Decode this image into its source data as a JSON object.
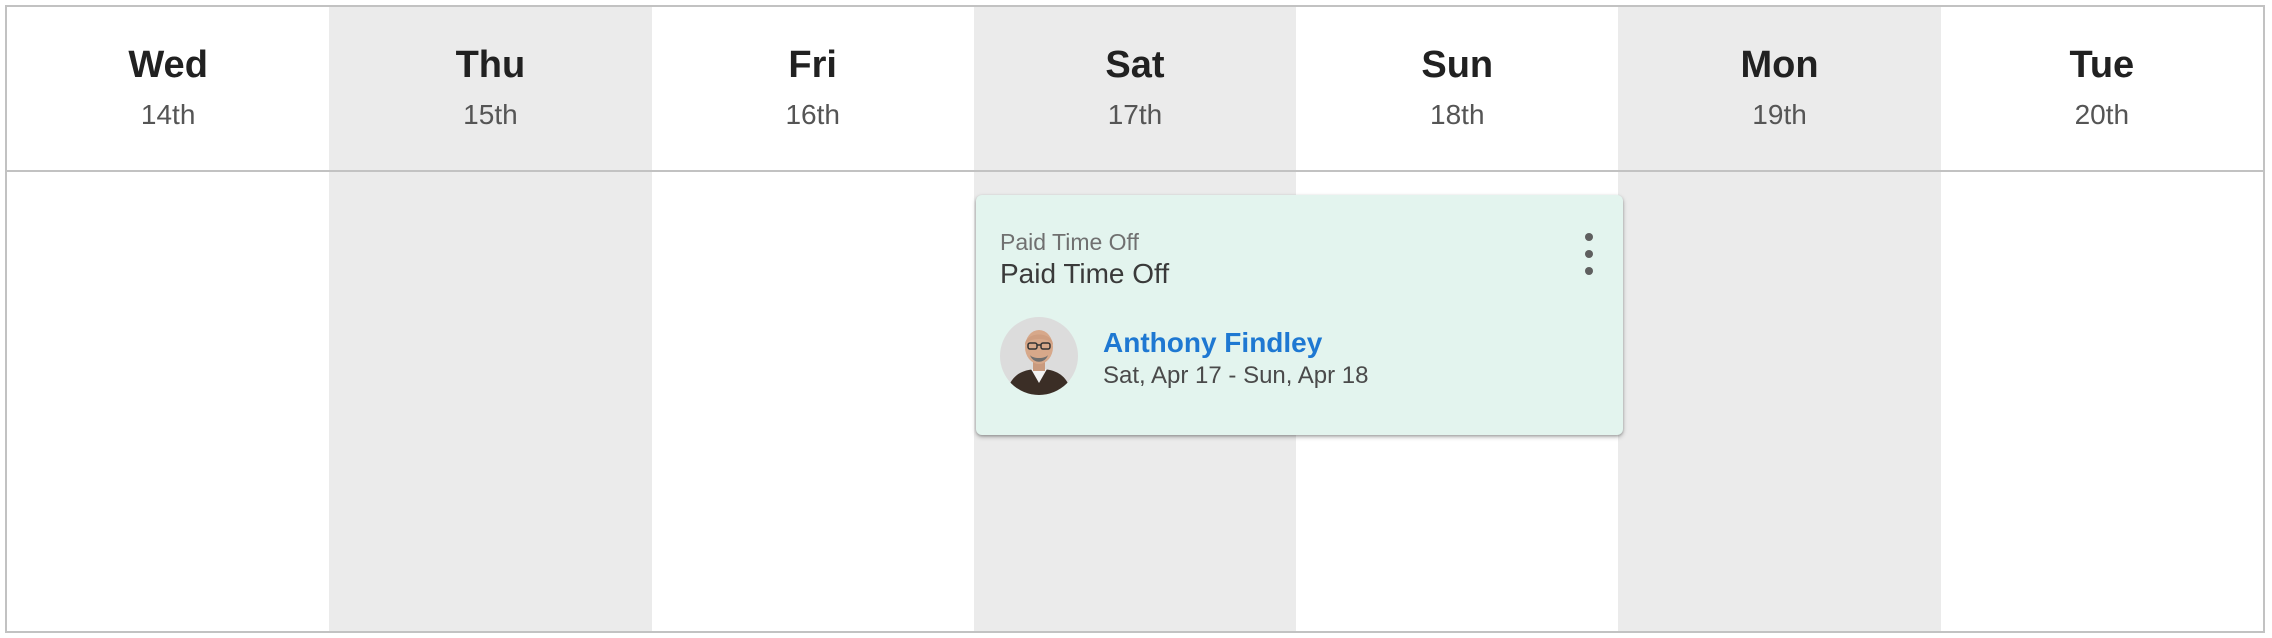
{
  "days": [
    {
      "name": "Wed",
      "date": "14th"
    },
    {
      "name": "Thu",
      "date": "15th"
    },
    {
      "name": "Fri",
      "date": "16th"
    },
    {
      "name": "Sat",
      "date": "17th"
    },
    {
      "name": "Sun",
      "date": "18th"
    },
    {
      "name": "Mon",
      "date": "19th"
    },
    {
      "name": "Tue",
      "date": "20th"
    }
  ],
  "event": {
    "type_label": "Paid Time Off",
    "title": "Paid Time Off",
    "person_name": "Anthony Findley",
    "date_range": "Sat, Apr 17 - Sun, Apr 18",
    "menu_icon": "more-vertical-icon",
    "card_color": "#e3f4ee",
    "name_color": "#1e78d2"
  },
  "colors": {
    "shaded_column": "#ebebeb",
    "border": "#c2c2c2"
  }
}
